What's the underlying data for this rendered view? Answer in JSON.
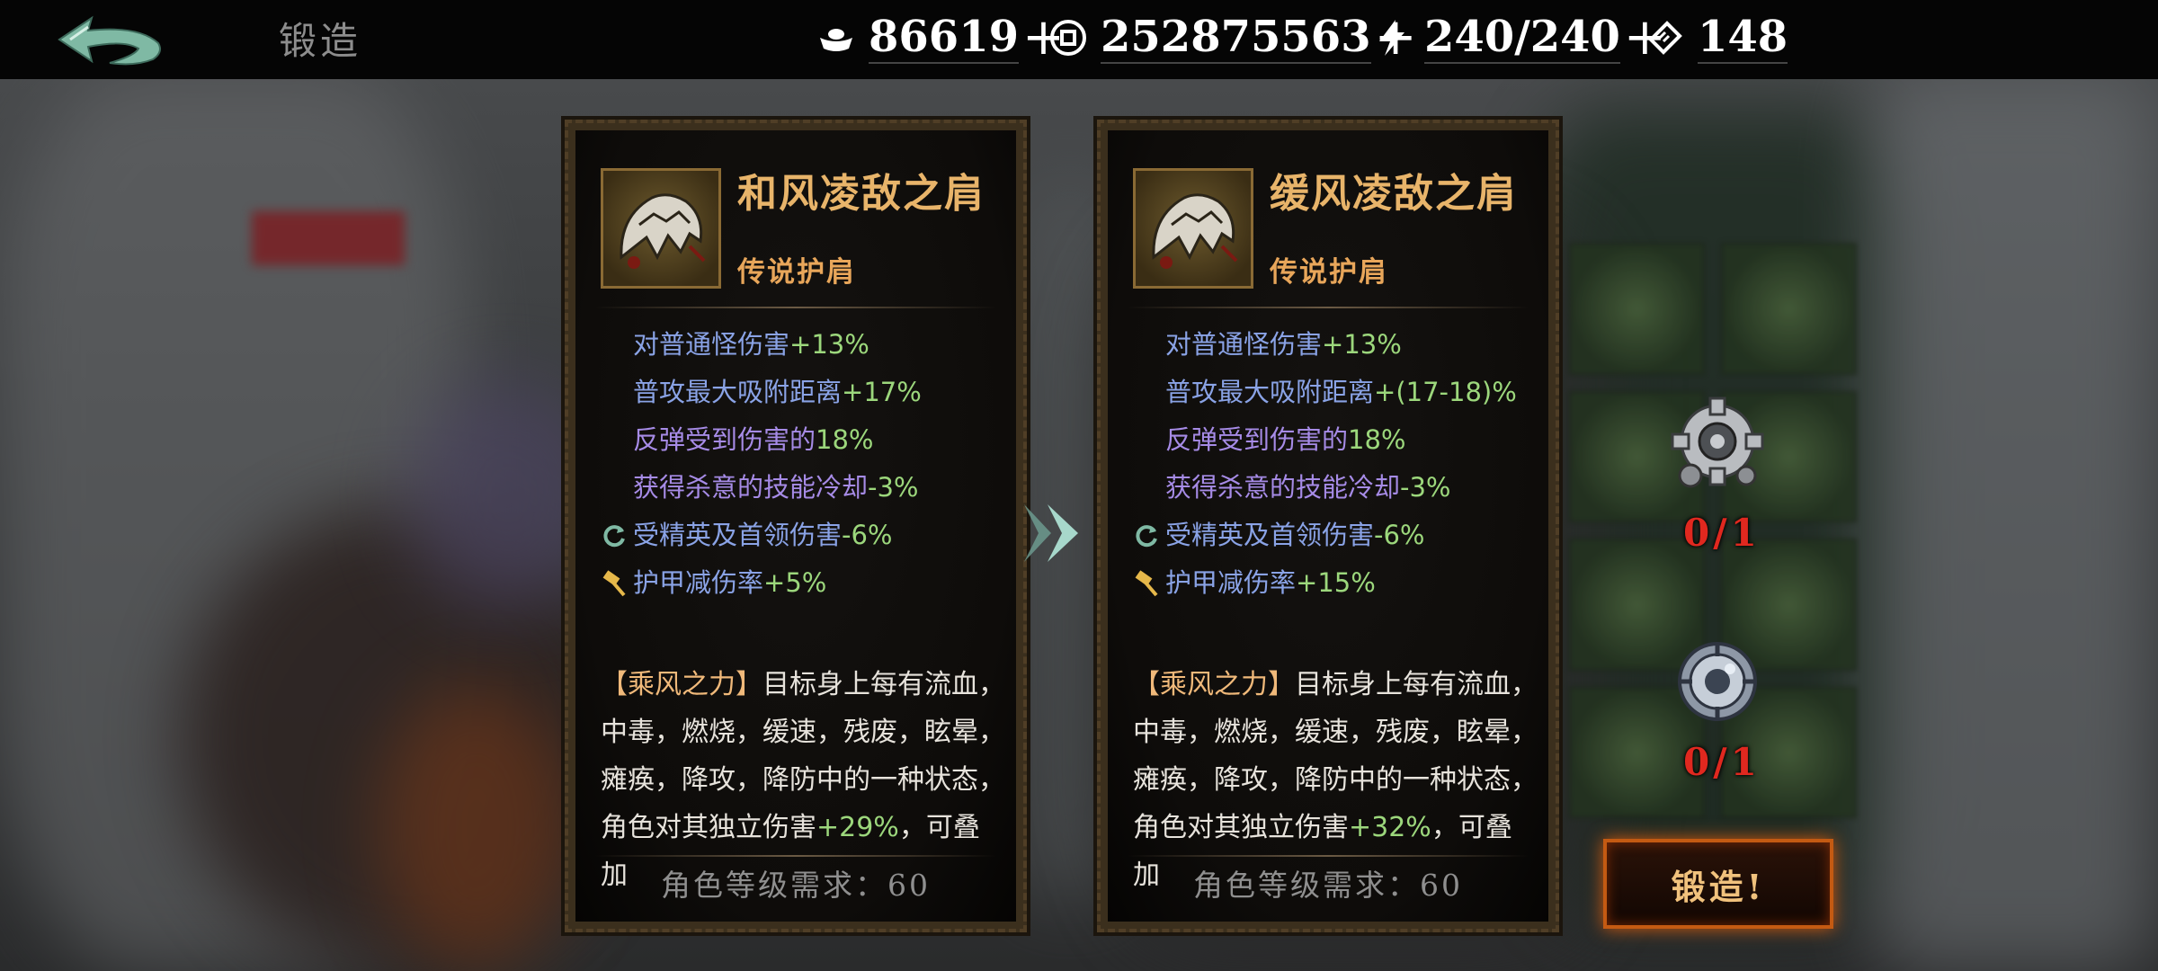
{
  "header": {
    "title": "锻造",
    "resources": [
      {
        "icon": "silver-ingot-icon",
        "value": "86619",
        "has_add": true
      },
      {
        "icon": "coin-icon",
        "value": "252875563",
        "has_add": true
      },
      {
        "icon": "energy-bolt-icon",
        "value": "240/240",
        "has_add": true
      },
      {
        "icon": "ticket-icon",
        "value": "148",
        "has_add": false
      }
    ],
    "add_glyph": "+"
  },
  "current_item": {
    "name": "和风凌敌之肩",
    "rarity": "传说护肩",
    "stats": [
      {
        "label": "对普通怪伤害",
        "value": "+13%",
        "color": "blue",
        "icon": ""
      },
      {
        "label": "普攻最大吸附距离",
        "value": "+17%",
        "color": "blue",
        "icon": ""
      },
      {
        "label": "反弹受到伤害的",
        "value": "18%",
        "color": "purple",
        "icon": ""
      },
      {
        "label": "获得杀意的技能冷却",
        "value": "-3%",
        "color": "purple",
        "icon": ""
      },
      {
        "label": "受精英及首领伤害",
        "value": "-6%",
        "color": "blue",
        "icon": "refresh-icon"
      },
      {
        "label": "护甲减伤率",
        "value": "+5%",
        "color": "blue",
        "icon": "hammer-icon"
      }
    ],
    "description": {
      "skill": "【乘风之力】",
      "line1": "目标身上每有流血，",
      "line2": "中毒，燃烧，缓速，残废，眩晕，",
      "line3": "瘫痪，降攻，降防中的一种状态，",
      "line4_prefix": "角色对其独立伤害",
      "line4_value": "+29%",
      "line4_suffix": "，可叠加"
    },
    "level_requirement": "角色等级需求：60"
  },
  "forged_item": {
    "name": "缓风凌敌之肩",
    "rarity": "传说护肩",
    "stats": [
      {
        "label": "对普通怪伤害",
        "value": "+13%",
        "color": "blue",
        "icon": ""
      },
      {
        "label": "普攻最大吸附距离",
        "value": "+(17-18)%",
        "color": "blue",
        "icon": ""
      },
      {
        "label": "反弹受到伤害的",
        "value": "18%",
        "color": "purple",
        "icon": ""
      },
      {
        "label": "获得杀意的技能冷却",
        "value": "-3%",
        "color": "purple",
        "icon": ""
      },
      {
        "label": "受精英及首领伤害",
        "value": "-6%",
        "color": "blue",
        "icon": "refresh-icon"
      },
      {
        "label": "护甲减伤率",
        "value": "+15%",
        "color": "blue",
        "icon": "hammer-icon"
      }
    ],
    "description": {
      "skill": "【乘风之力】",
      "line1": "目标身上每有流血，",
      "line2": "中毒，燃烧，缓速，残废，眩晕，",
      "line3": "瘫痪，降攻，降防中的一种状态，",
      "line4_prefix": "角色对其独立伤害",
      "line4_value": "+32%",
      "line4_suffix": "，可叠加"
    },
    "level_requirement": "角色等级需求：60"
  },
  "materials": [
    {
      "icon": "gear-material-icon",
      "count": "0/1"
    },
    {
      "icon": "round-gear-material-icon",
      "count": "0/1"
    }
  ],
  "forge_button": "锻造!",
  "colors": {
    "stat_blue": "#8aa3e6",
    "stat_purple": "#a68be6",
    "value_green": "#9cd77c",
    "item_name": "#e8b46a",
    "material_shortage": "#e0281f",
    "forge_glow": "#d05a10"
  }
}
